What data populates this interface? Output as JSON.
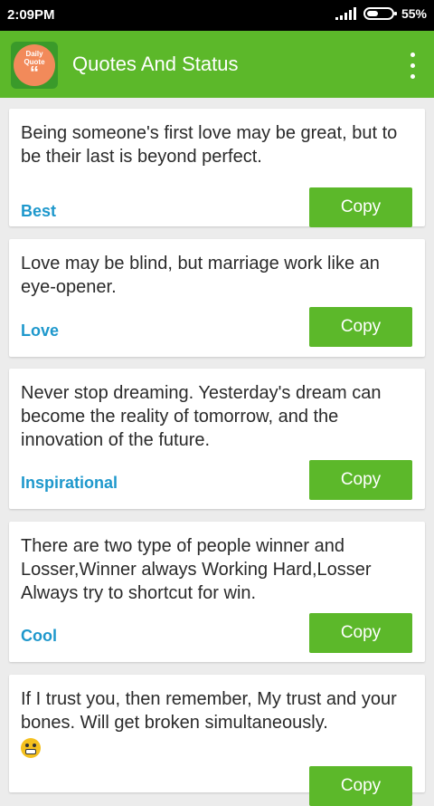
{
  "status_bar": {
    "time": "2:09PM",
    "battery": "55%"
  },
  "app_bar": {
    "logo_line1": "Daily",
    "logo_line2": "Quote",
    "logo_mark": "“",
    "title": "Quotes And Status",
    "menu_icon": "more-vert-icon"
  },
  "quotes": [
    {
      "text": "Being someone's first love may be great, but to be their last is beyond perfect.",
      "category": "Best",
      "button": "Copy"
    },
    {
      "text": "Love may be blind, but marriage work like an eye-opener.",
      "category": "Love",
      "button": "Copy"
    },
    {
      "text": "Never stop dreaming. Yesterday's dream can become the reality of tomorrow, and the innovation of the future.",
      "category": "Inspirational",
      "button": "Copy"
    },
    {
      "text": "There are two type of people winner and Losser,Winner always Working Hard,Losser Always try to shortcut for win.",
      "category": "Cool",
      "button": "Copy"
    },
    {
      "text": "If I trust you, then remember, My trust and your bones. Will get broken simultaneously.",
      "emoji": "grimacing-face-icon",
      "button": "Copy"
    }
  ],
  "colors": {
    "primary": "#5cb82a",
    "category": "#1e98cc",
    "background": "#ececec"
  }
}
